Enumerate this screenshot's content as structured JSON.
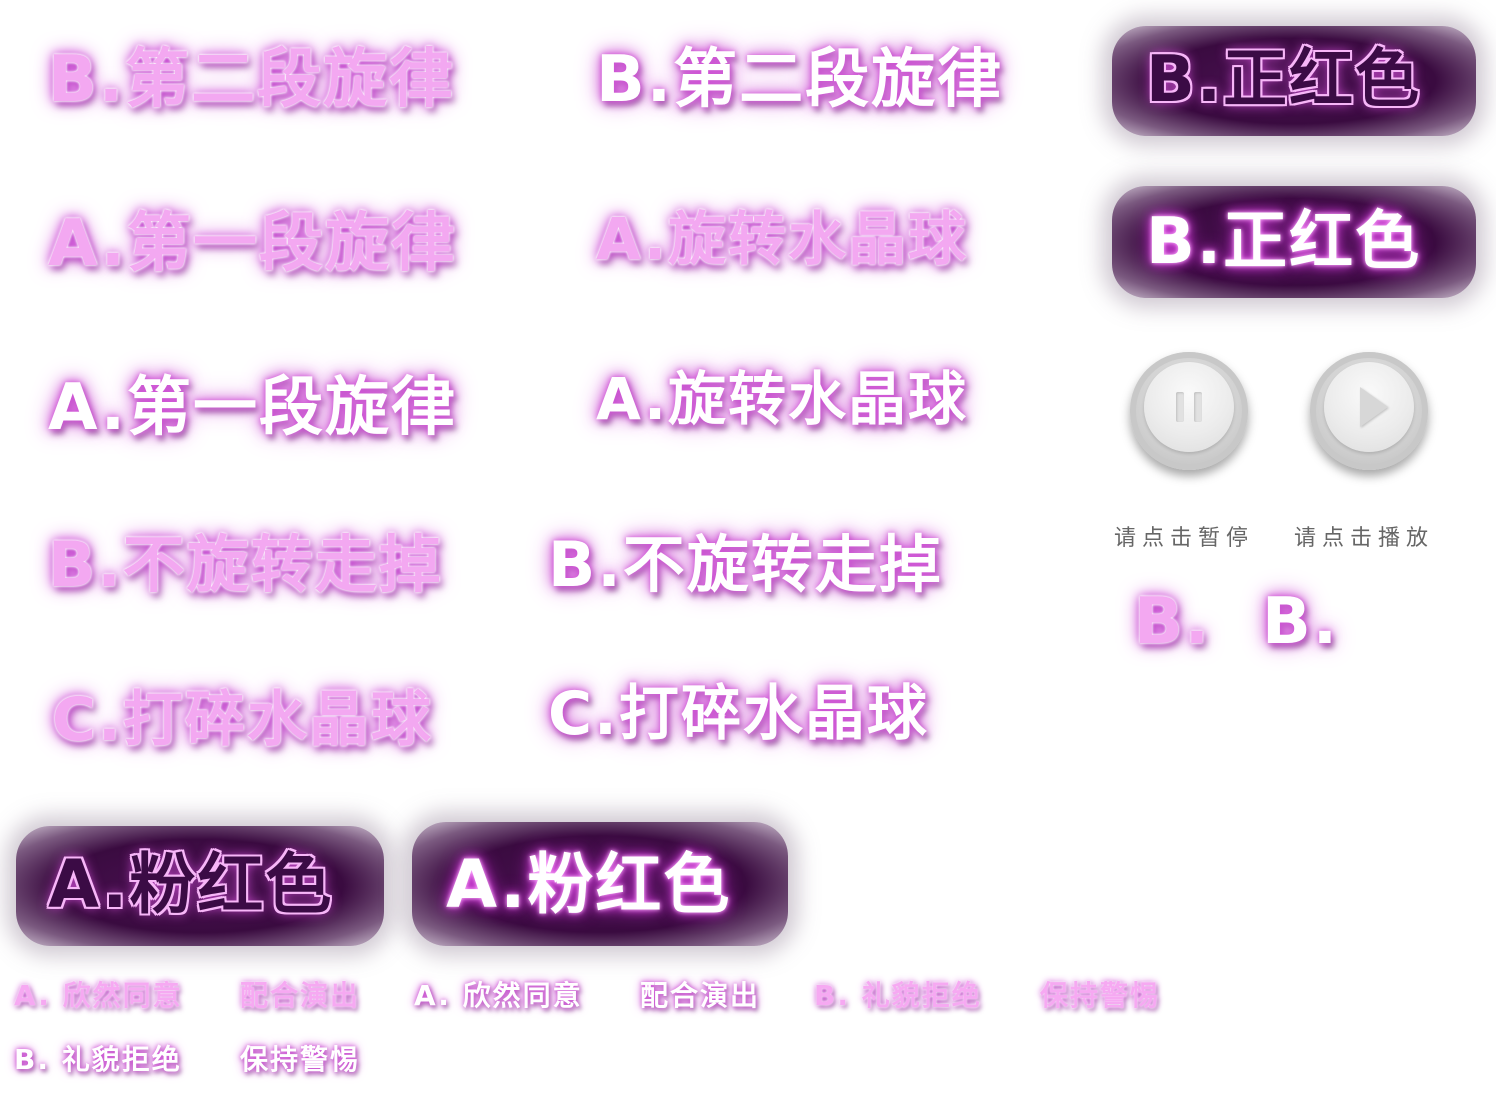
{
  "labels": {
    "b_second_melody": "B.第二段旋律",
    "a_first_melody": "A.第一段旋律",
    "a_rotate_crystal": "A.旋转水晶球",
    "b_no_rotate": "B.不旋转走掉",
    "c_break_crystal": "C.打碎水晶球",
    "b_red": "B.正红色",
    "a_pink": "A.粉红色",
    "b_short": "B."
  },
  "controls": {
    "pause_caption": "请点击暂停",
    "play_caption": "请点击播放"
  },
  "small_labels": {
    "a_accept": "A. 欣然同意",
    "a_cooperate": "配合演出",
    "b_refuse": "B. 礼貌拒绝",
    "b_alert": "保持警惕"
  },
  "colors": {
    "pink_text": "#f3a8f1",
    "glow": "#c848d0",
    "plate": "#3a0b40"
  },
  "icons": {
    "pause": "pause-icon",
    "play": "play-icon"
  }
}
